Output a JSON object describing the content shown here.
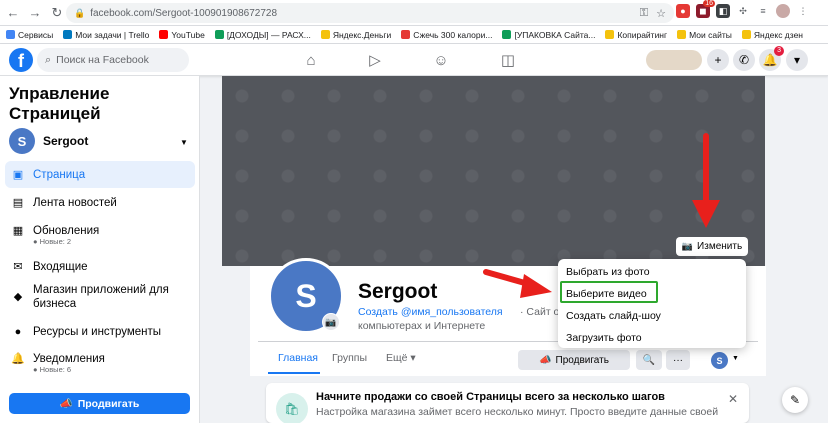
{
  "browser": {
    "url_host": "facebook.com",
    "url_path": "/Sergoot-100901908672728",
    "nav_back": "←",
    "nav_forward": "→",
    "reload": "↻"
  },
  "bookmarks": [
    {
      "label": "Сервисы",
      "color": "#4285f4"
    },
    {
      "label": "Мои задачи | Trello",
      "color": "#0079bf"
    },
    {
      "label": "YouTube",
      "color": "#ff0000"
    },
    {
      "label": "[ДОХОДЫ] — РАСХ...",
      "color": "#0f9d58"
    },
    {
      "label": "Яндекс.Деньги",
      "color": "#f4c20d"
    },
    {
      "label": "Сжечь 300 калори...",
      "color": "#e53935"
    },
    {
      "label": "[УПАКОВКА Сайта...",
      "color": "#0f9d58"
    },
    {
      "label": "Копирайтинг",
      "color": "#f4c20d"
    },
    {
      "label": "Мои сайты",
      "color": "#f4c20d"
    },
    {
      "label": "Яндекс дзен",
      "color": "#f4c20d"
    }
  ],
  "fb_header": {
    "logo": "f",
    "search_placeholder": "Поиск на Facebook",
    "notif_count": "3",
    "plus": "+",
    "caret": "▾"
  },
  "sidebar": {
    "title": "Управление Страницей",
    "page_name": "Sergoot",
    "page_initial": "S",
    "items": [
      {
        "label": "Страница",
        "icon": "page-icon",
        "glyph": "▣",
        "active": true,
        "sub": ""
      },
      {
        "label": "Лента новостей",
        "icon": "news-feed-icon",
        "glyph": "▤",
        "active": false,
        "sub": ""
      },
      {
        "label": "Обновления",
        "icon": "notifications-box-icon",
        "glyph": "▦",
        "active": false,
        "sub": "Новые: 2"
      },
      {
        "label": "Входящие",
        "icon": "inbox-icon",
        "glyph": "✉",
        "active": false,
        "sub": ""
      },
      {
        "label": "Магазин приложений для бизнеса",
        "icon": "app-store-icon",
        "glyph": "◆",
        "active": false,
        "sub": ""
      },
      {
        "label": "Ресурсы и инструменты",
        "icon": "resources-icon",
        "glyph": "●",
        "active": false,
        "sub": ""
      },
      {
        "label": "Уведомления",
        "icon": "bell-icon",
        "glyph": "🔔",
        "active": false,
        "sub": "Новые: 6"
      }
    ],
    "promote_label": "Продвигать"
  },
  "profile": {
    "initial": "S",
    "name": "Sergoot",
    "username_link": "Создать @имя_пользователя",
    "username_tail": "· Сайт о",
    "category": "компьютерах и Интернете"
  },
  "cover": {
    "edit_label": "Изменить"
  },
  "cover_menu": {
    "items": [
      "Выбрать из фото",
      "Выберите видео",
      "Создать слайд-шоу",
      "Загрузить фото"
    ],
    "highlighted": "Выберите видео"
  },
  "tabs": {
    "main": "Главная",
    "groups": "Группы",
    "more": "Ещё ▾"
  },
  "actions": {
    "promote": "Продвигать",
    "search": "🔍",
    "more": "···",
    "avatar_initial": "S"
  },
  "promo": {
    "title": "Начните продажи со своей Страницы всего за несколько шагов",
    "text": "Настройка магазина займет всего несколько минут. Просто введите данные своей",
    "close": "✕"
  },
  "colors": {
    "brand": "#1877f2",
    "annotation_arrow": "#e8201c",
    "annotation_box": "#2ea82e"
  }
}
